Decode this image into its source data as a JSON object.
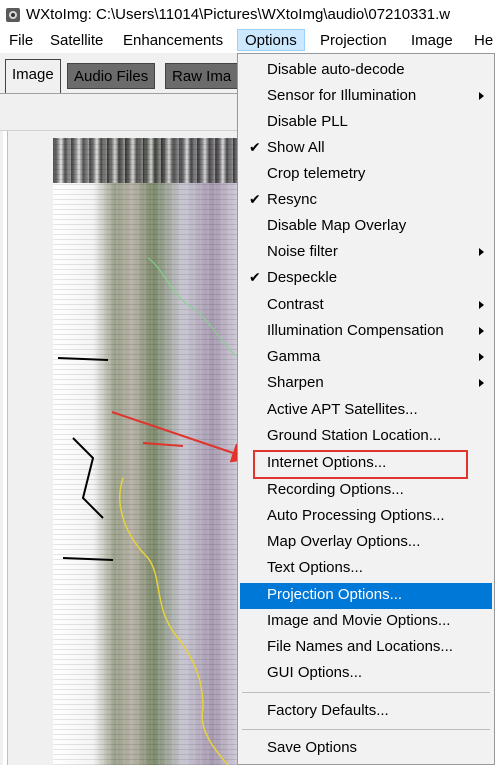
{
  "window": {
    "title": "WXtoImg: C:\\Users\\11014\\Pictures\\WXtoImg\\audio\\07210331.w"
  },
  "menubar": {
    "items": [
      "File",
      "Satellite",
      "Enhancements",
      "Options",
      "Projection",
      "Image",
      "He"
    ]
  },
  "tabs": [
    "Image",
    "Audio Files",
    "Raw Ima"
  ],
  "options_menu": {
    "items": [
      {
        "label": "Disable auto-decode",
        "checked": false,
        "submenu": false
      },
      {
        "label": "Sensor for Illumination",
        "checked": false,
        "submenu": true
      },
      {
        "label": "Disable PLL",
        "checked": false,
        "submenu": false
      },
      {
        "label": "Show All",
        "checked": true,
        "submenu": false
      },
      {
        "label": "Crop telemetry",
        "checked": false,
        "submenu": false
      },
      {
        "label": "Resync",
        "checked": true,
        "submenu": false
      },
      {
        "label": "Disable Map Overlay",
        "checked": false,
        "submenu": false
      },
      {
        "label": "Noise filter",
        "checked": false,
        "submenu": true
      },
      {
        "label": "Despeckle",
        "checked": true,
        "submenu": false
      },
      {
        "label": "Contrast",
        "checked": false,
        "submenu": true
      },
      {
        "label": "Illumination Compensation",
        "checked": false,
        "submenu": true
      },
      {
        "label": "Gamma",
        "checked": false,
        "submenu": true
      },
      {
        "label": "Sharpen",
        "checked": false,
        "submenu": true
      },
      {
        "label": "Active APT Satellites...",
        "checked": false,
        "submenu": false
      },
      {
        "label": "Ground Station Location...",
        "checked": false,
        "submenu": false
      },
      {
        "label": "Internet Options...",
        "checked": false,
        "submenu": false
      },
      {
        "label": "Recording Options...",
        "checked": false,
        "submenu": false
      },
      {
        "label": "Auto Processing Options...",
        "checked": false,
        "submenu": false
      },
      {
        "label": "Map Overlay Options...",
        "checked": false,
        "submenu": false
      },
      {
        "label": "Text Options...",
        "checked": false,
        "submenu": false
      },
      {
        "label": "Projection Options...",
        "checked": false,
        "submenu": false
      },
      {
        "label": "Image and Movie Options...",
        "checked": false,
        "submenu": false
      },
      {
        "label": "File Names and Locations...",
        "checked": false,
        "submenu": false
      },
      {
        "label": "GUI Options...",
        "checked": false,
        "submenu": false
      },
      {
        "label": "Factory Defaults...",
        "checked": false,
        "submenu": false
      },
      {
        "label": "Save Options",
        "checked": false,
        "submenu": false
      }
    ],
    "highlighted": "Projection Options...",
    "annotated": "Internet Options..."
  },
  "colors": {
    "highlight": "#0078d7",
    "annotation": "#e0342c",
    "menu_active": "#cce8ff"
  },
  "icons": {
    "app": "wxtoimg-app-icon",
    "check": "check-icon",
    "submenu": "submenu-arrow-icon"
  }
}
